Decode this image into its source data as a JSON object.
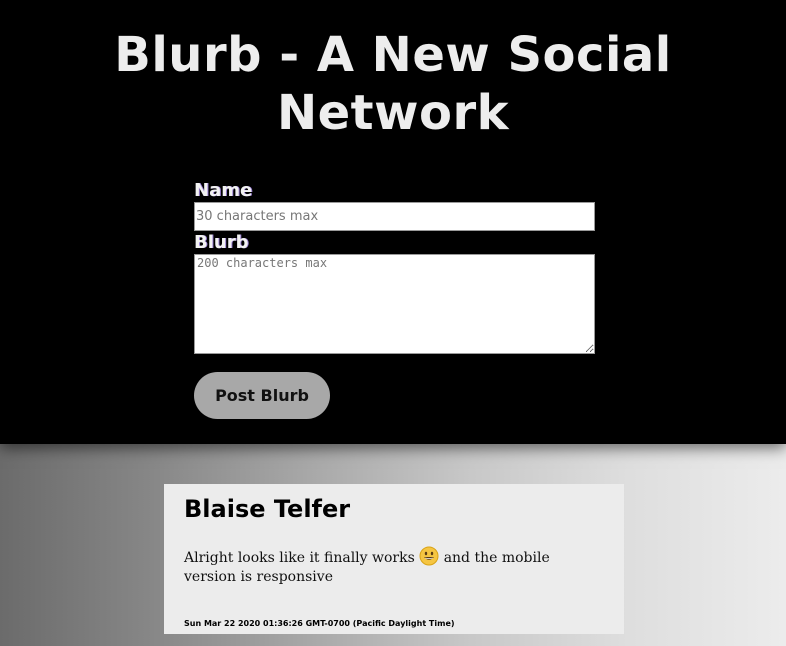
{
  "page": {
    "title_line1": "Blurb - A New Social",
    "title_line2": "Network"
  },
  "form": {
    "name_label": "Name",
    "name_placeholder": "30 characters max",
    "name_value": "",
    "blurb_label": "Blurb",
    "blurb_placeholder": "200 characters max",
    "blurb_value": "",
    "post_button_label": "Post Blurb"
  },
  "posts": [
    {
      "author": "Blaise Telfer",
      "text_before_emoji": "Alright looks like it finally works",
      "emoji": "grinning-face-emoji",
      "text_after_emoji": "and the mobile version is responsive",
      "timestamp": "Sun Mar 22 2020 01:36:26 GMT-0700 (Pacific Daylight Time)"
    }
  ],
  "colors": {
    "header_bg": "#000000",
    "title_text": "#ededed",
    "button_bg": "#a8a8a8",
    "card_bg": "#ececec"
  }
}
